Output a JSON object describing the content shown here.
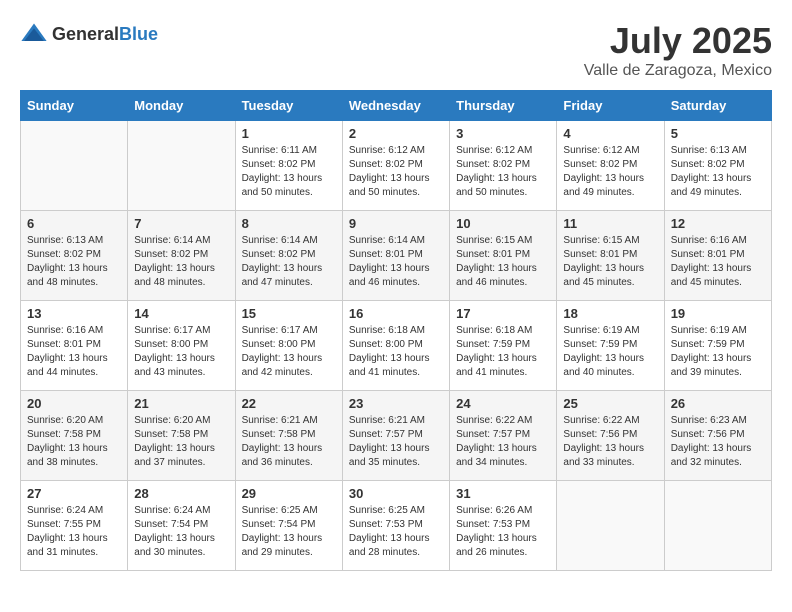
{
  "header": {
    "logo_general": "General",
    "logo_blue": "Blue",
    "month": "July 2025",
    "location": "Valle de Zaragoza, Mexico"
  },
  "days_of_week": [
    "Sunday",
    "Monday",
    "Tuesday",
    "Wednesday",
    "Thursday",
    "Friday",
    "Saturday"
  ],
  "weeks": [
    [
      {
        "day": "",
        "empty": true
      },
      {
        "day": "",
        "empty": true
      },
      {
        "day": "1",
        "sunrise": "Sunrise: 6:11 AM",
        "sunset": "Sunset: 8:02 PM",
        "daylight": "Daylight: 13 hours and 50 minutes."
      },
      {
        "day": "2",
        "sunrise": "Sunrise: 6:12 AM",
        "sunset": "Sunset: 8:02 PM",
        "daylight": "Daylight: 13 hours and 50 minutes."
      },
      {
        "day": "3",
        "sunrise": "Sunrise: 6:12 AM",
        "sunset": "Sunset: 8:02 PM",
        "daylight": "Daylight: 13 hours and 50 minutes."
      },
      {
        "day": "4",
        "sunrise": "Sunrise: 6:12 AM",
        "sunset": "Sunset: 8:02 PM",
        "daylight": "Daylight: 13 hours and 49 minutes."
      },
      {
        "day": "5",
        "sunrise": "Sunrise: 6:13 AM",
        "sunset": "Sunset: 8:02 PM",
        "daylight": "Daylight: 13 hours and 49 minutes."
      }
    ],
    [
      {
        "day": "6",
        "sunrise": "Sunrise: 6:13 AM",
        "sunset": "Sunset: 8:02 PM",
        "daylight": "Daylight: 13 hours and 48 minutes."
      },
      {
        "day": "7",
        "sunrise": "Sunrise: 6:14 AM",
        "sunset": "Sunset: 8:02 PM",
        "daylight": "Daylight: 13 hours and 48 minutes."
      },
      {
        "day": "8",
        "sunrise": "Sunrise: 6:14 AM",
        "sunset": "Sunset: 8:02 PM",
        "daylight": "Daylight: 13 hours and 47 minutes."
      },
      {
        "day": "9",
        "sunrise": "Sunrise: 6:14 AM",
        "sunset": "Sunset: 8:01 PM",
        "daylight": "Daylight: 13 hours and 46 minutes."
      },
      {
        "day": "10",
        "sunrise": "Sunrise: 6:15 AM",
        "sunset": "Sunset: 8:01 PM",
        "daylight": "Daylight: 13 hours and 46 minutes."
      },
      {
        "day": "11",
        "sunrise": "Sunrise: 6:15 AM",
        "sunset": "Sunset: 8:01 PM",
        "daylight": "Daylight: 13 hours and 45 minutes."
      },
      {
        "day": "12",
        "sunrise": "Sunrise: 6:16 AM",
        "sunset": "Sunset: 8:01 PM",
        "daylight": "Daylight: 13 hours and 45 minutes."
      }
    ],
    [
      {
        "day": "13",
        "sunrise": "Sunrise: 6:16 AM",
        "sunset": "Sunset: 8:01 PM",
        "daylight": "Daylight: 13 hours and 44 minutes."
      },
      {
        "day": "14",
        "sunrise": "Sunrise: 6:17 AM",
        "sunset": "Sunset: 8:00 PM",
        "daylight": "Daylight: 13 hours and 43 minutes."
      },
      {
        "day": "15",
        "sunrise": "Sunrise: 6:17 AM",
        "sunset": "Sunset: 8:00 PM",
        "daylight": "Daylight: 13 hours and 42 minutes."
      },
      {
        "day": "16",
        "sunrise": "Sunrise: 6:18 AM",
        "sunset": "Sunset: 8:00 PM",
        "daylight": "Daylight: 13 hours and 41 minutes."
      },
      {
        "day": "17",
        "sunrise": "Sunrise: 6:18 AM",
        "sunset": "Sunset: 7:59 PM",
        "daylight": "Daylight: 13 hours and 41 minutes."
      },
      {
        "day": "18",
        "sunrise": "Sunrise: 6:19 AM",
        "sunset": "Sunset: 7:59 PM",
        "daylight": "Daylight: 13 hours and 40 minutes."
      },
      {
        "day": "19",
        "sunrise": "Sunrise: 6:19 AM",
        "sunset": "Sunset: 7:59 PM",
        "daylight": "Daylight: 13 hours and 39 minutes."
      }
    ],
    [
      {
        "day": "20",
        "sunrise": "Sunrise: 6:20 AM",
        "sunset": "Sunset: 7:58 PM",
        "daylight": "Daylight: 13 hours and 38 minutes."
      },
      {
        "day": "21",
        "sunrise": "Sunrise: 6:20 AM",
        "sunset": "Sunset: 7:58 PM",
        "daylight": "Daylight: 13 hours and 37 minutes."
      },
      {
        "day": "22",
        "sunrise": "Sunrise: 6:21 AM",
        "sunset": "Sunset: 7:58 PM",
        "daylight": "Daylight: 13 hours and 36 minutes."
      },
      {
        "day": "23",
        "sunrise": "Sunrise: 6:21 AM",
        "sunset": "Sunset: 7:57 PM",
        "daylight": "Daylight: 13 hours and 35 minutes."
      },
      {
        "day": "24",
        "sunrise": "Sunrise: 6:22 AM",
        "sunset": "Sunset: 7:57 PM",
        "daylight": "Daylight: 13 hours and 34 minutes."
      },
      {
        "day": "25",
        "sunrise": "Sunrise: 6:22 AM",
        "sunset": "Sunset: 7:56 PM",
        "daylight": "Daylight: 13 hours and 33 minutes."
      },
      {
        "day": "26",
        "sunrise": "Sunrise: 6:23 AM",
        "sunset": "Sunset: 7:56 PM",
        "daylight": "Daylight: 13 hours and 32 minutes."
      }
    ],
    [
      {
        "day": "27",
        "sunrise": "Sunrise: 6:24 AM",
        "sunset": "Sunset: 7:55 PM",
        "daylight": "Daylight: 13 hours and 31 minutes."
      },
      {
        "day": "28",
        "sunrise": "Sunrise: 6:24 AM",
        "sunset": "Sunset: 7:54 PM",
        "daylight": "Daylight: 13 hours and 30 minutes."
      },
      {
        "day": "29",
        "sunrise": "Sunrise: 6:25 AM",
        "sunset": "Sunset: 7:54 PM",
        "daylight": "Daylight: 13 hours and 29 minutes."
      },
      {
        "day": "30",
        "sunrise": "Sunrise: 6:25 AM",
        "sunset": "Sunset: 7:53 PM",
        "daylight": "Daylight: 13 hours and 28 minutes."
      },
      {
        "day": "31",
        "sunrise": "Sunrise: 6:26 AM",
        "sunset": "Sunset: 7:53 PM",
        "daylight": "Daylight: 13 hours and 26 minutes."
      },
      {
        "day": "",
        "empty": true
      },
      {
        "day": "",
        "empty": true
      }
    ]
  ]
}
